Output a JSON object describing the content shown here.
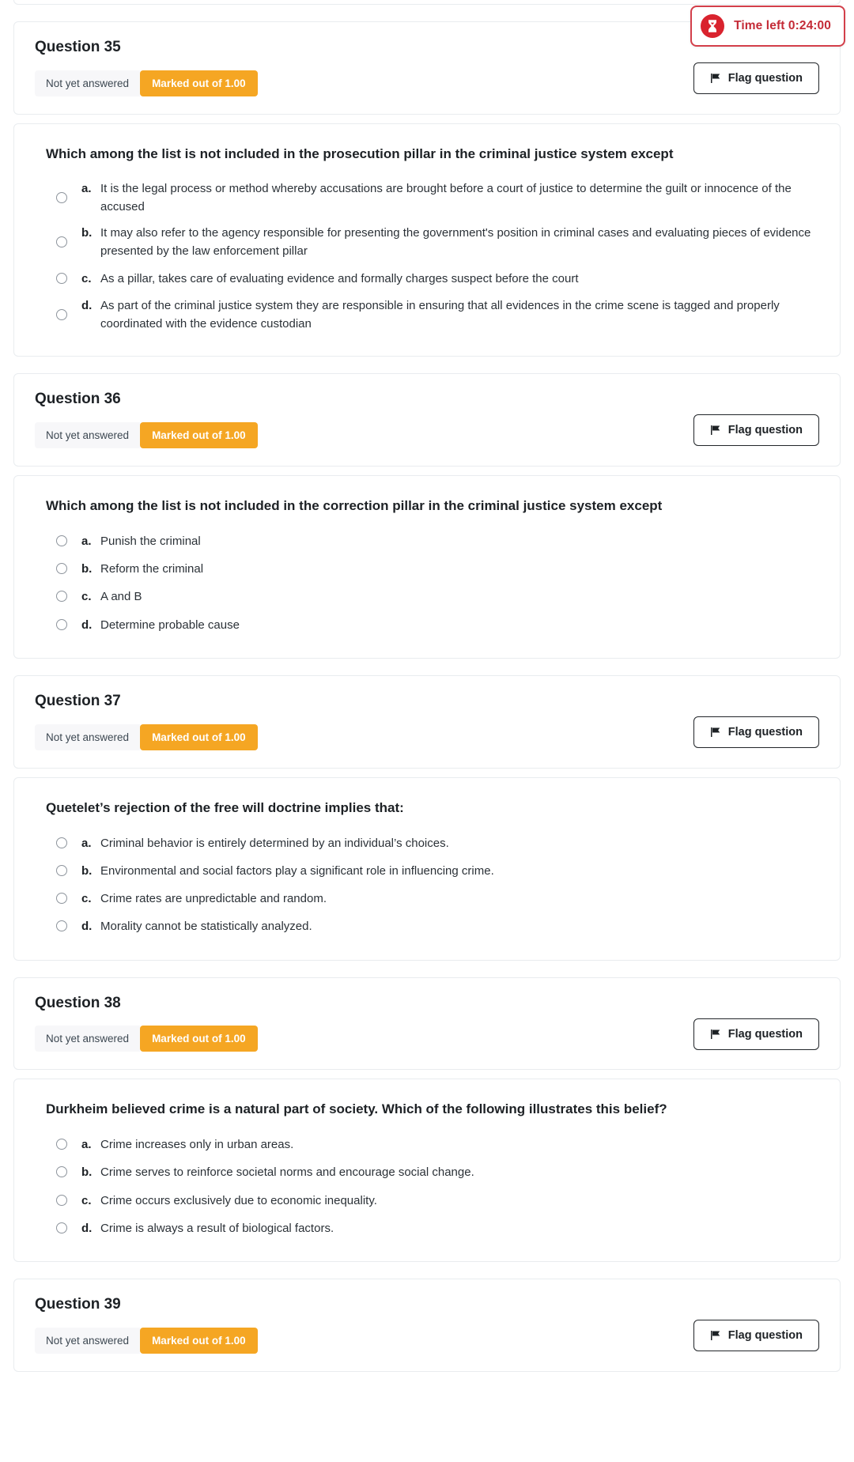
{
  "timer": {
    "label": "Time left 0:24:00",
    "icon": "hourglass-icon",
    "accent_color": "#d33f4a",
    "text_color": "#c42b37"
  },
  "labels": {
    "state_not_answered": "Not yet answered",
    "grade_marked_out_of": "Marked out of 1.00",
    "flag_question": "Flag question"
  },
  "colors": {
    "grade_badge_bg": "#f5a623",
    "state_badge_bg": "#f7f7f9",
    "card_border": "#e9ecef"
  },
  "questions": [
    {
      "number": "Question 35",
      "state": "Not yet answered",
      "grade": "Marked out of 1.00",
      "flag_label": "Flag question",
      "text": "Which among the list is not included in the prosecution pillar in the criminal justice system except",
      "answers": [
        {
          "letter": "a.",
          "text": "It is the legal process or method whereby accusations are brought before a court of justice to determine the guilt or innocence of the accused",
          "multiline": true
        },
        {
          "letter": "b.",
          "text": "It may also refer to the agency responsible for presenting the government's position in criminal cases and evaluating pieces of evidence presented by the law enforcement pillar",
          "multiline": true
        },
        {
          "letter": "c.",
          "text": "As a pillar, takes care of evaluating evidence and formally charges suspect before the court",
          "multiline": false
        },
        {
          "letter": "d.",
          "text": "As part of the criminal justice system they are responsible in ensuring that all evidences in the crime scene is tagged and properly coordinated with the evidence custodian",
          "multiline": true
        }
      ]
    },
    {
      "number": "Question 36",
      "state": "Not yet answered",
      "grade": "Marked out of 1.00",
      "flag_label": "Flag question",
      "text": "Which among the list is not included in the correction pillar in the criminal justice system except",
      "answers": [
        {
          "letter": "a.",
          "text": "Punish the criminal",
          "multiline": false
        },
        {
          "letter": "b.",
          "text": "Reform the criminal",
          "multiline": false
        },
        {
          "letter": "c.",
          "text": "A and B",
          "multiline": false
        },
        {
          "letter": "d.",
          "text": "Determine probable cause",
          "multiline": false
        }
      ]
    },
    {
      "number": "Question 37",
      "state": "Not yet answered",
      "grade": "Marked out of 1.00",
      "flag_label": "Flag question",
      "text": "Quetelet’s rejection of the free will doctrine implies that:",
      "answers": [
        {
          "letter": "a.",
          "text": "Criminal behavior is entirely determined by an individual’s choices.",
          "multiline": false
        },
        {
          "letter": "b.",
          "text": "Environmental and social factors play a significant role in influencing crime.",
          "multiline": false
        },
        {
          "letter": "c.",
          "text": "Crime rates are unpredictable and random.",
          "multiline": false
        },
        {
          "letter": "d.",
          "text": "Morality cannot be statistically analyzed.",
          "multiline": false
        }
      ]
    },
    {
      "number": "Question 38",
      "state": "Not yet answered",
      "grade": "Marked out of 1.00",
      "flag_label": "Flag question",
      "text": "Durkheim believed crime is a natural part of society. Which of the following illustrates this belief?",
      "answers": [
        {
          "letter": "a.",
          "text": "Crime increases only in urban areas.",
          "multiline": false
        },
        {
          "letter": "b.",
          "text": "Crime serves to reinforce societal norms and encourage social change.",
          "multiline": false
        },
        {
          "letter": "c.",
          "text": "Crime occurs exclusively due to economic inequality.",
          "multiline": false
        },
        {
          "letter": "d.",
          "text": "Crime is always a result of biological factors.",
          "multiline": false
        }
      ]
    },
    {
      "number": "Question 39",
      "state": "Not yet answered",
      "grade": "Marked out of 1.00",
      "flag_label": "Flag question",
      "text": "",
      "answers": [],
      "partial": true
    }
  ]
}
